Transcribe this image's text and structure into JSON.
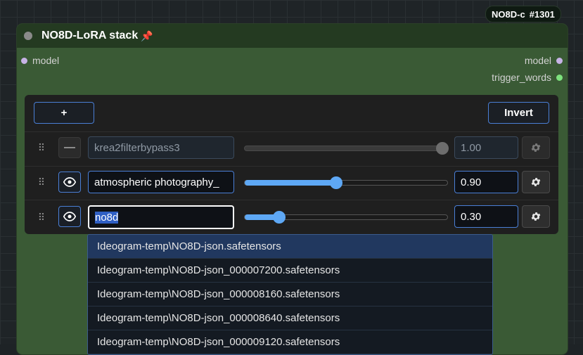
{
  "canvas": {
    "badge_prefix": "NO8D-c",
    "badge_id": "#1301"
  },
  "node": {
    "title": "NO8D-LoRA stack",
    "pin_icon": "pushpin-icon",
    "input_model": "model",
    "output_model": "model",
    "output_trigger": "trigger_words"
  },
  "toolbar": {
    "add_label": "+",
    "invert_label": "Invert"
  },
  "rows": [
    {
      "enabled": false,
      "toggle_icon": "dash-icon",
      "name": "krea2filterbypass3",
      "strength": "1.00",
      "slider_fraction": 1.0
    },
    {
      "enabled": true,
      "toggle_icon": "eye-icon",
      "name": "atmospheric photography_",
      "strength": "0.90",
      "slider_fraction": 0.45
    },
    {
      "enabled": true,
      "toggle_icon": "eye-icon",
      "name": "no8d",
      "strength": "0.30",
      "slider_fraction": 0.17
    }
  ],
  "dropdown": {
    "options": [
      "Ideogram-temp\\NO8D-json.safetensors",
      "Ideogram-temp\\NO8D-json_000007200.safetensors",
      "Ideogram-temp\\NO8D-json_000008160.safetensors",
      "Ideogram-temp\\NO8D-json_000008640.safetensors",
      "Ideogram-temp\\NO8D-json_000009120.safetensors"
    ],
    "highlighted_index": 0
  },
  "colors": {
    "node_body": "#3a5a35",
    "node_header": "#243a21",
    "accent_blue": "#4a7fd6",
    "slider_blue": "#5ea8f5"
  }
}
